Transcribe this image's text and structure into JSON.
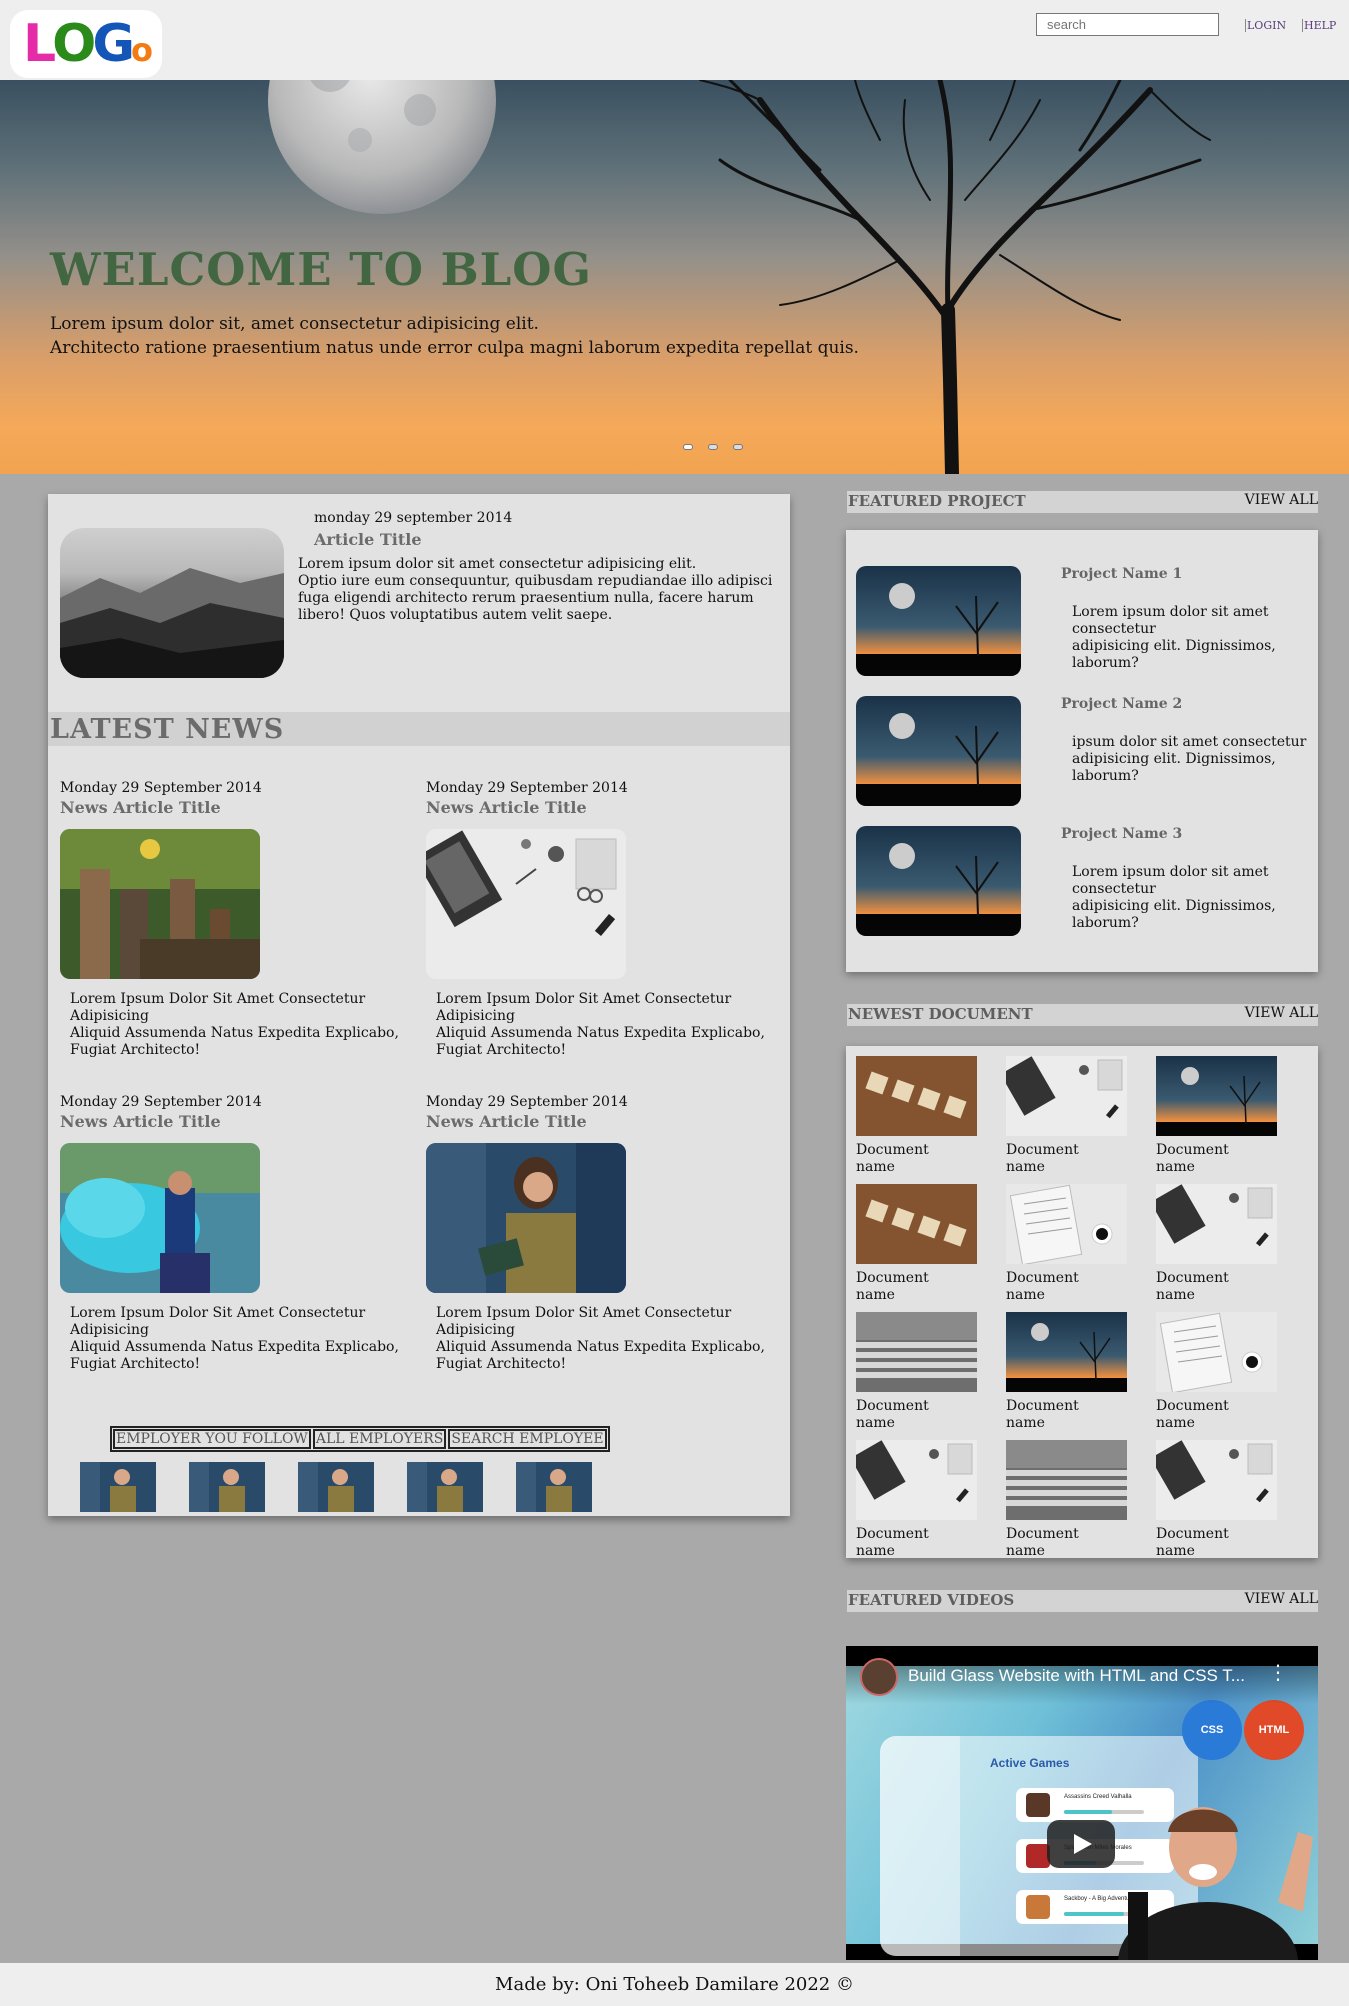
{
  "header": {
    "logo_letters": [
      "L",
      "O",
      "G",
      "o"
    ],
    "logo_colors": [
      "#e52ba8",
      "#2a8a1a",
      "#1456b8",
      "#f47a12"
    ],
    "search_placeholder": "search",
    "login_label": "LOGIN",
    "help_label": "HELP"
  },
  "hero": {
    "title": "WELCOME TO BLOG",
    "subtitle_line1": "Lorem ipsum dolor sit, amet consectetur adipisicing elit.",
    "subtitle_line2": "Architecto ratione praesentium natus unde error culpa magni laborum expedita repellat quis.",
    "slides": 3,
    "active_slide": 0
  },
  "featured_article": {
    "date": "monday 29 september 2014",
    "title": "Article Title",
    "body_line1": "Lorem ipsum dolor sit amet consectetur adipisicing elit.",
    "body_line2": "Optio iure eum consequuntur, quibusdam repudiandae illo adipisci fuga eligendi architecto rerum praesentium nulla, facere harum libero! Quos voluptatibus autem velit saepe."
  },
  "latest_news": {
    "heading": "LATEST NEWS",
    "items": [
      {
        "date": "Monday 29 September 2014",
        "title": "News Article Title",
        "text_line1": "Lorem Ipsum Dolor Sit Amet Consectetur Adipisicing",
        "text_line2": "Aliquid Assumenda Natus Expedita Explicabo, Fugiat Architecto!",
        "image": "children-forest"
      },
      {
        "date": "Monday 29 September 2014",
        "title": "News Article Title",
        "text_line1": "Lorem Ipsum Dolor Sit Amet Consectetur Adipisicing",
        "text_line2": "Aliquid Assumenda Natus Expedita Explicabo, Fugiat Architecto!",
        "image": "desk-laptop"
      },
      {
        "date": "Monday 29 September 2014",
        "title": "News Article Title",
        "text_line1": "Lorem Ipsum Dolor Sit Amet Consectetur Adipisicing",
        "text_line2": "Aliquid Assumenda Natus Expedita Explicabo, Fugiat Architecto!",
        "image": "blue-smoke"
      },
      {
        "date": "Monday 29 September 2014",
        "title": "News Article Title",
        "text_line1": "Lorem Ipsum Dolor Sit Amet Consectetur Adipisicing",
        "text_line2": "Aliquid Assumenda Natus Expedita Explicabo, Fugiat Architecto!",
        "image": "woman-reading"
      }
    ]
  },
  "employers": {
    "tabs": [
      "EMPLOYER YOU FOLLOW",
      "ALL EMPLOYERS",
      "SEARCH EMPLOYEE"
    ],
    "thumb_count": 5
  },
  "featured_project": {
    "heading": "FEATURED PROJECT",
    "view_all": "VIEW ALL",
    "items": [
      {
        "name": "Project Name 1",
        "desc_line1": "Lorem ipsum dolor sit amet consectetur",
        "desc_line2": "adipisicing elit. Dignissimos, laborum?"
      },
      {
        "name": "Project Name 2",
        "desc_line1": "ipsum dolor sit amet consectetur",
        "desc_line2": "adipisicing elit. Dignissimos, laborum?"
      },
      {
        "name": "Project Name 3",
        "desc_line1": "Lorem ipsum dolor sit amet consectetur",
        "desc_line2": "adipisicing elit. Dignissimos, laborum?"
      }
    ]
  },
  "newest_document": {
    "heading": "NEWEST DOCUMENT",
    "view_all": "VIEW ALL",
    "items": [
      {
        "label": "Document name",
        "image": "blog-tiles"
      },
      {
        "label": "Document name",
        "image": "desk-laptop"
      },
      {
        "label": "Document name",
        "image": "moon-tree"
      },
      {
        "label": "Document name",
        "image": "blog-tiles"
      },
      {
        "label": "Document name",
        "image": "newspaper"
      },
      {
        "label": "Document name",
        "image": "desk-laptop"
      },
      {
        "label": "Document name",
        "image": "paper-stack"
      },
      {
        "label": "Document name",
        "image": "moon-tree"
      },
      {
        "label": "Document name",
        "image": "newspaper"
      },
      {
        "label": "Document name",
        "image": "desk-laptop"
      },
      {
        "label": "Document name",
        "image": "paper-stack"
      },
      {
        "label": "Document name",
        "image": "desk-laptop"
      }
    ]
  },
  "featured_videos": {
    "heading": "FEATURED VIDEOS",
    "view_all": "VIEW ALL",
    "video_title": "Build Glass Website with HTML and CSS T...",
    "panel_heading": "Active Games",
    "games": [
      {
        "name": "Assassins Creed Valhalla",
        "progress": 0.6
      },
      {
        "name": "Spiderman Miles Morales",
        "progress": 0.4
      },
      {
        "name": "Sackboy - A Big Adventure",
        "progress": 0.75
      }
    ],
    "badges": [
      "CSS",
      "HTML"
    ]
  },
  "footer": {
    "text": "Made by: Oni Toheeb Damilare 2022 ©"
  }
}
